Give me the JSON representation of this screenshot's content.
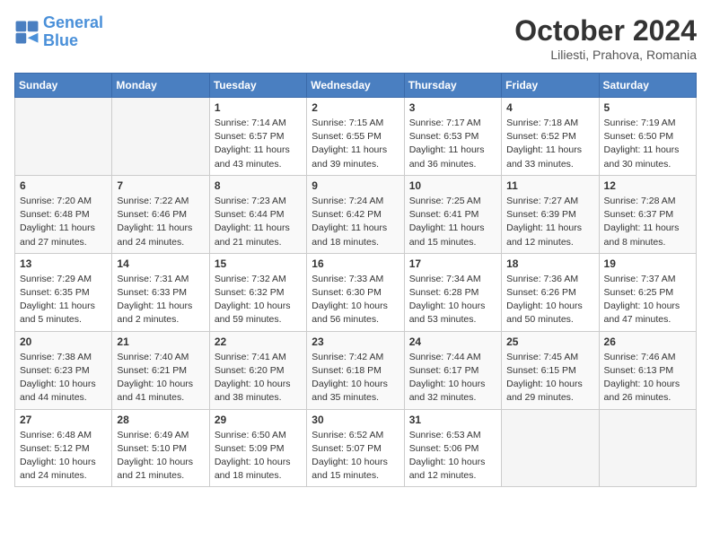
{
  "header": {
    "logo_line1": "General",
    "logo_line2": "Blue",
    "month": "October 2024",
    "location": "Liliesti, Prahova, Romania"
  },
  "days_of_week": [
    "Sunday",
    "Monday",
    "Tuesday",
    "Wednesday",
    "Thursday",
    "Friday",
    "Saturday"
  ],
  "weeks": [
    [
      {
        "day": "",
        "info": ""
      },
      {
        "day": "",
        "info": ""
      },
      {
        "day": "1",
        "info": "Sunrise: 7:14 AM\nSunset: 6:57 PM\nDaylight: 11 hours and 43 minutes."
      },
      {
        "day": "2",
        "info": "Sunrise: 7:15 AM\nSunset: 6:55 PM\nDaylight: 11 hours and 39 minutes."
      },
      {
        "day": "3",
        "info": "Sunrise: 7:17 AM\nSunset: 6:53 PM\nDaylight: 11 hours and 36 minutes."
      },
      {
        "day": "4",
        "info": "Sunrise: 7:18 AM\nSunset: 6:52 PM\nDaylight: 11 hours and 33 minutes."
      },
      {
        "day": "5",
        "info": "Sunrise: 7:19 AM\nSunset: 6:50 PM\nDaylight: 11 hours and 30 minutes."
      }
    ],
    [
      {
        "day": "6",
        "info": "Sunrise: 7:20 AM\nSunset: 6:48 PM\nDaylight: 11 hours and 27 minutes."
      },
      {
        "day": "7",
        "info": "Sunrise: 7:22 AM\nSunset: 6:46 PM\nDaylight: 11 hours and 24 minutes."
      },
      {
        "day": "8",
        "info": "Sunrise: 7:23 AM\nSunset: 6:44 PM\nDaylight: 11 hours and 21 minutes."
      },
      {
        "day": "9",
        "info": "Sunrise: 7:24 AM\nSunset: 6:42 PM\nDaylight: 11 hours and 18 minutes."
      },
      {
        "day": "10",
        "info": "Sunrise: 7:25 AM\nSunset: 6:41 PM\nDaylight: 11 hours and 15 minutes."
      },
      {
        "day": "11",
        "info": "Sunrise: 7:27 AM\nSunset: 6:39 PM\nDaylight: 11 hours and 12 minutes."
      },
      {
        "day": "12",
        "info": "Sunrise: 7:28 AM\nSunset: 6:37 PM\nDaylight: 11 hours and 8 minutes."
      }
    ],
    [
      {
        "day": "13",
        "info": "Sunrise: 7:29 AM\nSunset: 6:35 PM\nDaylight: 11 hours and 5 minutes."
      },
      {
        "day": "14",
        "info": "Sunrise: 7:31 AM\nSunset: 6:33 PM\nDaylight: 11 hours and 2 minutes."
      },
      {
        "day": "15",
        "info": "Sunrise: 7:32 AM\nSunset: 6:32 PM\nDaylight: 10 hours and 59 minutes."
      },
      {
        "day": "16",
        "info": "Sunrise: 7:33 AM\nSunset: 6:30 PM\nDaylight: 10 hours and 56 minutes."
      },
      {
        "day": "17",
        "info": "Sunrise: 7:34 AM\nSunset: 6:28 PM\nDaylight: 10 hours and 53 minutes."
      },
      {
        "day": "18",
        "info": "Sunrise: 7:36 AM\nSunset: 6:26 PM\nDaylight: 10 hours and 50 minutes."
      },
      {
        "day": "19",
        "info": "Sunrise: 7:37 AM\nSunset: 6:25 PM\nDaylight: 10 hours and 47 minutes."
      }
    ],
    [
      {
        "day": "20",
        "info": "Sunrise: 7:38 AM\nSunset: 6:23 PM\nDaylight: 10 hours and 44 minutes."
      },
      {
        "day": "21",
        "info": "Sunrise: 7:40 AM\nSunset: 6:21 PM\nDaylight: 10 hours and 41 minutes."
      },
      {
        "day": "22",
        "info": "Sunrise: 7:41 AM\nSunset: 6:20 PM\nDaylight: 10 hours and 38 minutes."
      },
      {
        "day": "23",
        "info": "Sunrise: 7:42 AM\nSunset: 6:18 PM\nDaylight: 10 hours and 35 minutes."
      },
      {
        "day": "24",
        "info": "Sunrise: 7:44 AM\nSunset: 6:17 PM\nDaylight: 10 hours and 32 minutes."
      },
      {
        "day": "25",
        "info": "Sunrise: 7:45 AM\nSunset: 6:15 PM\nDaylight: 10 hours and 29 minutes."
      },
      {
        "day": "26",
        "info": "Sunrise: 7:46 AM\nSunset: 6:13 PM\nDaylight: 10 hours and 26 minutes."
      }
    ],
    [
      {
        "day": "27",
        "info": "Sunrise: 6:48 AM\nSunset: 5:12 PM\nDaylight: 10 hours and 24 minutes."
      },
      {
        "day": "28",
        "info": "Sunrise: 6:49 AM\nSunset: 5:10 PM\nDaylight: 10 hours and 21 minutes."
      },
      {
        "day": "29",
        "info": "Sunrise: 6:50 AM\nSunset: 5:09 PM\nDaylight: 10 hours and 18 minutes."
      },
      {
        "day": "30",
        "info": "Sunrise: 6:52 AM\nSunset: 5:07 PM\nDaylight: 10 hours and 15 minutes."
      },
      {
        "day": "31",
        "info": "Sunrise: 6:53 AM\nSunset: 5:06 PM\nDaylight: 10 hours and 12 minutes."
      },
      {
        "day": "",
        "info": ""
      },
      {
        "day": "",
        "info": ""
      }
    ]
  ]
}
